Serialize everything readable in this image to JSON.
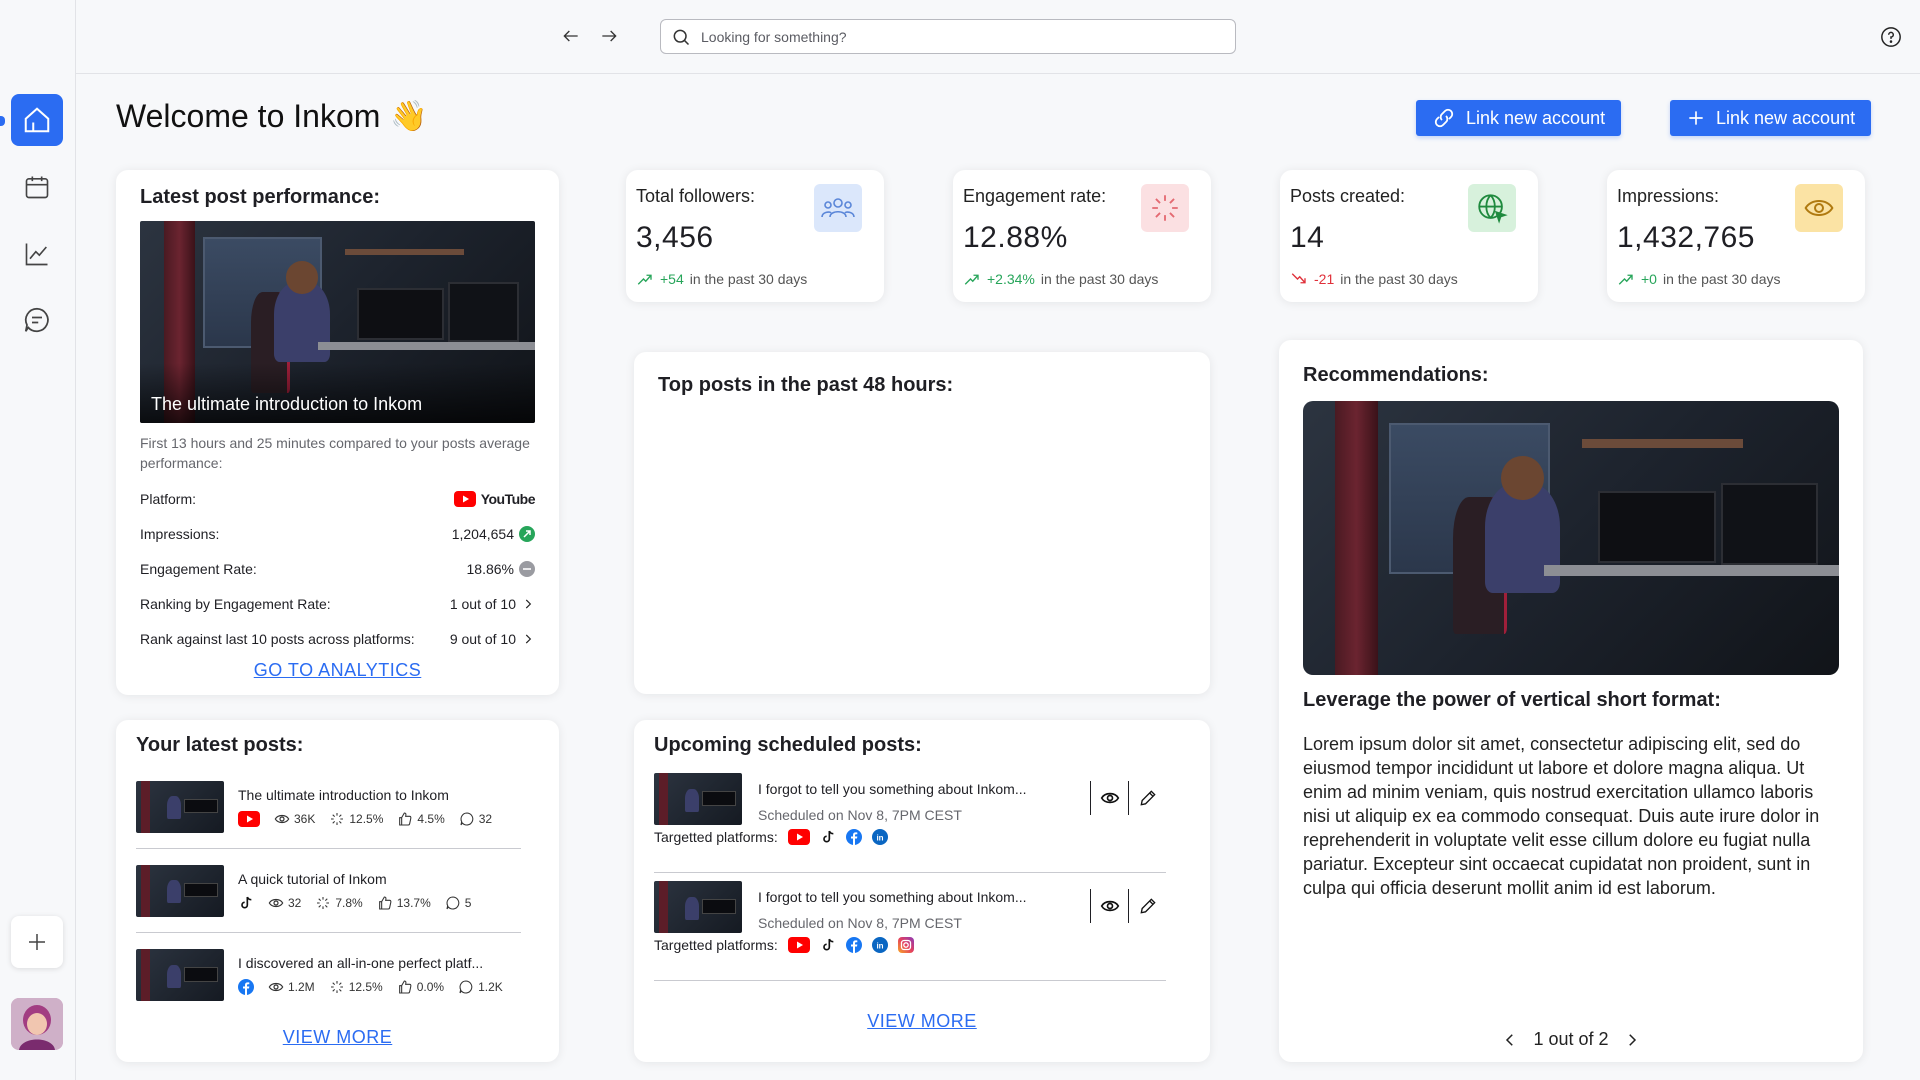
{
  "header": {
    "title": "Welcome to Inkom",
    "emoji": "👋",
    "btn_link1": "Link new account",
    "btn_link2": "Link new account"
  },
  "search": {
    "placeholder": "Looking for something?"
  },
  "stats": [
    {
      "label": "Total followers:",
      "value": "3,456",
      "delta": "+54",
      "suffix": "in the past 30 days",
      "trend": "up",
      "icon": "users-icon",
      "color": "#dbe7fb"
    },
    {
      "label": "Engagement rate:",
      "value": "12.88%",
      "delta": "+2.34%",
      "suffix": "in the past 30 days",
      "trend": "up",
      "icon": "spinner-icon",
      "color": "#fbe0e2"
    },
    {
      "label": "Posts created:",
      "value": "14",
      "delta": "-21",
      "suffix": "in the past 30 days",
      "trend": "down",
      "icon": "globe-icon",
      "color": "#d7f1dc"
    },
    {
      "label": "Impressions:",
      "value": "1,432,765",
      "delta": "+0",
      "suffix": "in the past 30 days",
      "trend": "up",
      "icon": "eye-icon",
      "color": "#fbe3a4"
    }
  ],
  "perf": {
    "title": "Latest post performance:",
    "caption": "The ultimate introduction to Inkom",
    "subtitle": "First 13 hours and 25 minutes compared to your posts average performance:",
    "rows": [
      {
        "label": "Platform:",
        "value": "YouTube"
      },
      {
        "label": "Impressions:",
        "value": "1,204,654"
      },
      {
        "label": "Engagement Rate:",
        "value": "18.86%"
      },
      {
        "label": "Ranking by Engagement Rate:",
        "value": "1 out of 10"
      },
      {
        "label": "Rank against last 10 posts across platforms:",
        "value": "9 out of 10"
      }
    ],
    "cta": "GO TO ANALYTICS"
  },
  "top48": {
    "title": "Top posts in the past 48 hours:"
  },
  "reco": {
    "title": "Recommendations:",
    "heading": "Leverage the power of vertical short format:",
    "body": "Lorem ipsum dolor sit amet, consectetur adipiscing elit, sed do eiusmod tempor incididunt ut labore et dolore magna aliqua. Ut enim ad minim veniam, quis nostrud exercitation ullamco laboris nisi ut aliquip ex ea commodo consequat. Duis aute irure dolor in reprehenderit in voluptate velit esse cillum dolore eu fugiat nulla pariatur. Excepteur sint occaecat cupidatat non proident, sunt in culpa qui officia deserunt mollit anim id est laborum.",
    "pager": "1 out of 2"
  },
  "latest": {
    "title": "Your latest posts:",
    "posts": [
      {
        "title": "The ultimate introduction to Inkom",
        "platform": "youtube",
        "views": "36K",
        "engagement": "12.5%",
        "likes": "4.5%",
        "comments": "32"
      },
      {
        "title": "A quick tutorial of Inkom",
        "platform": "tiktok",
        "views": "32",
        "engagement": "7.8%",
        "likes": "13.7%",
        "comments": "5"
      },
      {
        "title": "I  discovered an all-in-one perfect platf...",
        "platform": "facebook",
        "views": "1.2M",
        "engagement": "12.5%",
        "likes": "0.0%",
        "comments": "1.2K"
      }
    ],
    "cta": "VIEW MORE"
  },
  "upcoming": {
    "title": "Upcoming scheduled posts:",
    "items": [
      {
        "title": "I forgot to tell you something about Inkom...",
        "when": "Scheduled on Nov 8, 7PM CEST",
        "targets_label": "Targetted platforms:",
        "platforms": [
          "youtube",
          "tiktok",
          "facebook",
          "linkedin"
        ]
      },
      {
        "title": "I forgot to tell you something about Inkom...",
        "when": "Scheduled on Nov 8, 7PM CEST",
        "targets_label": "Targetted platforms:",
        "platforms": [
          "youtube",
          "tiktok",
          "facebook",
          "linkedin",
          "instagram"
        ]
      }
    ],
    "cta": "VIEW MORE"
  },
  "colors": {
    "accent": "#2b6cf2",
    "up": "#27a55a",
    "down": "#e0303a"
  }
}
